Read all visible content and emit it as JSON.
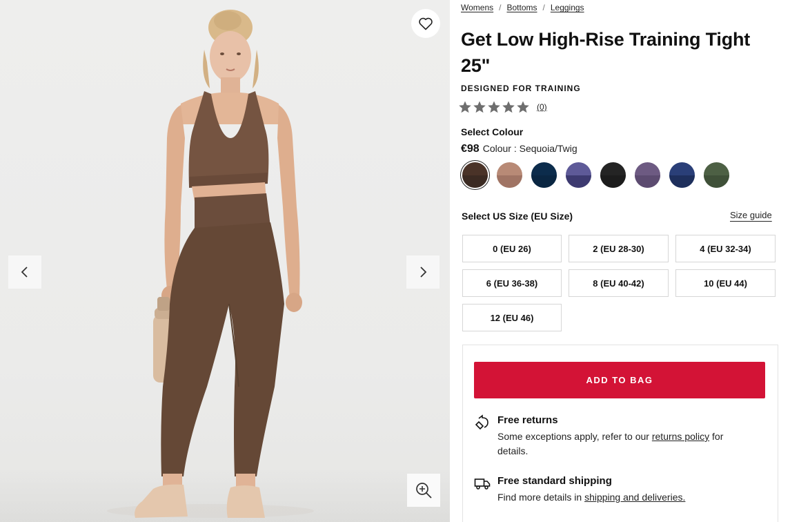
{
  "gallery": {
    "wishlist_icon": "heart-outline-icon",
    "prev_icon": "chevron-left-icon",
    "next_icon": "chevron-right-icon",
    "zoom_icon": "zoom-in-icon"
  },
  "breadcrumb": [
    {
      "label": "Womens"
    },
    {
      "label": "Bottoms"
    },
    {
      "label": "Leggings"
    }
  ],
  "breadcrumb_separator": "/",
  "product": {
    "title": "Get Low High-Rise Training Tight 25\"",
    "tagline": "DESIGNED FOR TRAINING",
    "rating": 0,
    "review_count": "(0)",
    "select_colour_label": "Select Colour",
    "price": "€98",
    "colour_label": "Colour : Sequoia/Twig"
  },
  "swatches": [
    {
      "top": "#4a3328",
      "bottom": "#3b2a22",
      "selected": true
    },
    {
      "top": "#b88a76",
      "bottom": "#a07464",
      "selected": false
    },
    {
      "top": "#0c2c4c",
      "bottom": "#0a2642",
      "selected": false
    },
    {
      "top": "#5e5a98",
      "bottom": "#3d3a70",
      "selected": false
    },
    {
      "top": "#242424",
      "bottom": "#1c1c1c",
      "selected": false
    },
    {
      "top": "#6d5a82",
      "bottom": "#5c4b70",
      "selected": false
    },
    {
      "top": "#2a3f78",
      "bottom": "#1e2f5c",
      "selected": false
    },
    {
      "top": "#4d6044",
      "bottom": "#3f5038",
      "selected": false
    }
  ],
  "sizing": {
    "label": "Select US Size (EU Size)",
    "guide_label": "Size guide",
    "sizes": [
      "0 (EU 26)",
      "2 (EU 28-30)",
      "4 (EU 32-34)",
      "6 (EU 36-38)",
      "8 (EU 40-42)",
      "10 (EU 44)",
      "12 (EU 46)"
    ]
  },
  "purchase": {
    "add_to_bag": "ADD TO BAG",
    "accent_color": "#d31336"
  },
  "benefits": {
    "returns": {
      "icon": "returns-arrow-icon",
      "title": "Free returns",
      "text_before": "Some exceptions apply, refer to our ",
      "link": "returns policy",
      "text_after": " for details."
    },
    "shipping": {
      "icon": "delivery-truck-icon",
      "title": "Free standard shipping",
      "text_before": "Find more details in ",
      "link": "shipping and deliveries."
    }
  }
}
